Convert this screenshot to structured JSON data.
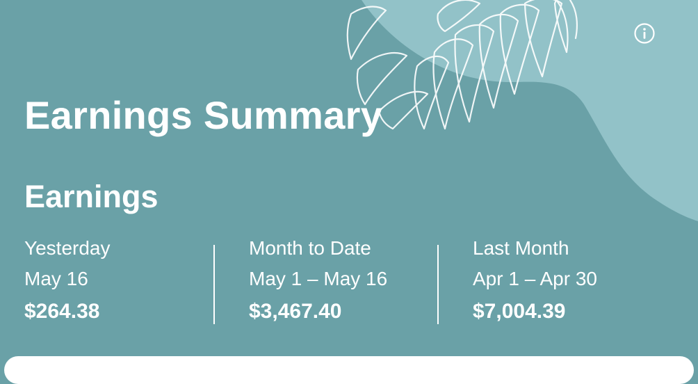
{
  "header": {
    "title": "Earnings Summary",
    "info_icon": "info-icon"
  },
  "earnings": {
    "section_title": "Earnings",
    "periods": [
      {
        "label": "Yesterday",
        "range": "May 16",
        "amount": "$264.38"
      },
      {
        "label": "Month to Date",
        "range": "May 1 – May 16",
        "amount": "$3,467.40"
      },
      {
        "label": "Last Month",
        "range": "Apr 1 – Apr 30",
        "amount": "$7,004.39"
      }
    ]
  },
  "colors": {
    "background": "#6aa1a7",
    "blob": "#92c2c8",
    "text": "#ffffff"
  }
}
